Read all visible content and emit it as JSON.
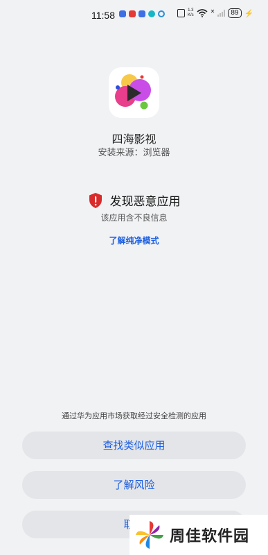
{
  "status_bar": {
    "time": "11:58",
    "network_speed_value": "1.3",
    "network_speed_unit": "K/s",
    "battery": "89",
    "notification_icons": [
      "app-notif-blue-icon",
      "app-notif-red-icon",
      "app-notif-blue-square-icon",
      "app-notif-teal-icon",
      "app-notif-ring-icon"
    ]
  },
  "app": {
    "name": "四海影视",
    "source": "安装来源：浏览器",
    "icon": "play-bubbles-icon"
  },
  "warning": {
    "title": "发现恶意应用",
    "description": "该应用含不良信息",
    "link": "了解纯净模式",
    "icon": "shield-alert-icon",
    "accent": "#d92b2b"
  },
  "bottom": {
    "hint": "通过华为应用市场获取经过安全检测的应用",
    "buttons": [
      {
        "label": "查找类似应用"
      },
      {
        "label": "了解风险"
      },
      {
        "label": "取消"
      }
    ],
    "button_text_color": "#1c5fe0",
    "button_bg": "#e4e5e8"
  },
  "watermark": {
    "text": "周佳软件园"
  }
}
